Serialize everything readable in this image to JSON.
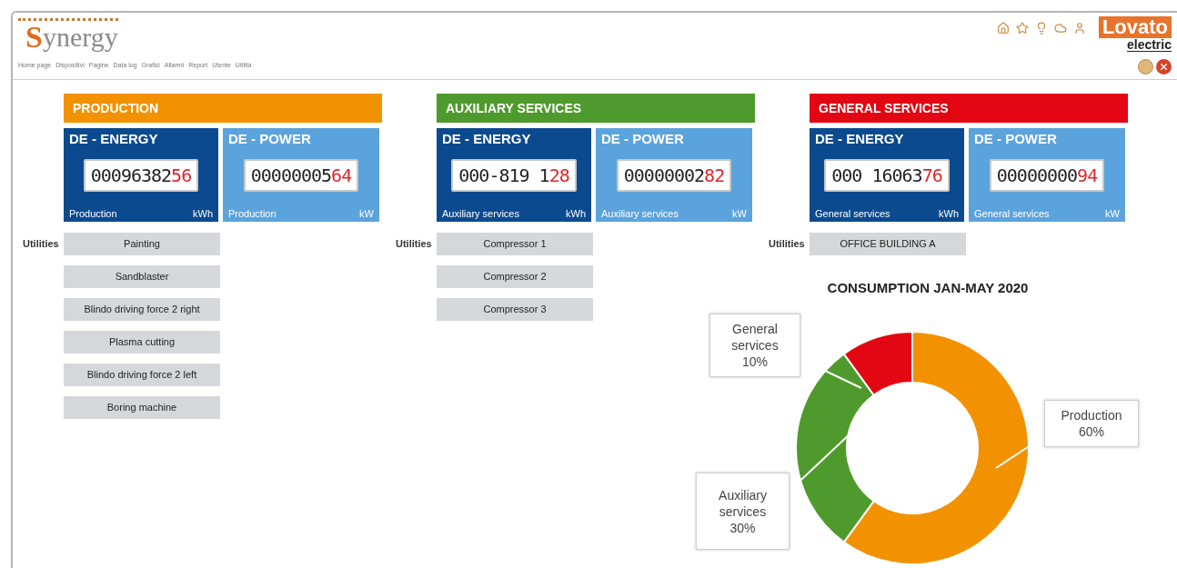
{
  "header": {
    "logo_initial": "S",
    "logo_rest": "ynergy",
    "nav": [
      "Home page",
      "Dispositivi",
      "Pagine",
      "Data log",
      "Grafici",
      "Allarmi",
      "Report",
      "Utente",
      "Utilità"
    ],
    "brand": {
      "name": "Lovato",
      "sub": "electric"
    }
  },
  "groups": [
    {
      "title": "PRODUCTION",
      "color": "#f39200",
      "meters": [
        {
          "kind": "energy",
          "title": "DE - ENERGY",
          "digits": "00096382",
          "red_digits": "56",
          "caption": "Production",
          "unit": "kWh"
        },
        {
          "kind": "power",
          "title": "DE - POWER",
          "digits": "00000005",
          "red_digits": "64",
          "caption": "Production",
          "unit": "kW"
        }
      ],
      "utilities_label": "Utilities",
      "utilities": [
        "Painting",
        "Sandblaster",
        "Blindo driving force 2 right",
        "Plasma cutting",
        "Blindo driving force 2 left",
        "Boring machine"
      ]
    },
    {
      "title": "AUXILIARY SERVICES",
      "color": "#4f9a2c",
      "meters": [
        {
          "kind": "energy",
          "title": "DE - ENERGY",
          "digits": "000-819 1",
          "red_digits": "28",
          "caption": "Auxiliary services",
          "unit": "kWh"
        },
        {
          "kind": "power",
          "title": "DE - POWER",
          "digits": "00000002",
          "red_digits": "82",
          "caption": "Auxiliary services",
          "unit": "kW"
        }
      ],
      "utilities_label": "Utilities",
      "utilities": [
        "Compressor 1",
        "Compressor 2",
        "Compressor 3"
      ]
    },
    {
      "title": "GENERAL SERVICES",
      "color": "#e30613",
      "meters": [
        {
          "kind": "energy",
          "title": "DE - ENERGY",
          "digits": "000 16063",
          "red_digits": "76",
          "caption": "General services",
          "unit": "kWh"
        },
        {
          "kind": "power",
          "title": "DE - POWER",
          "digits": "00000000",
          "red_digits": "94",
          "caption": "General services",
          "unit": "kW"
        }
      ],
      "utilities_label": "Utilities",
      "utilities": [
        "OFFICE BUILDING A"
      ]
    }
  ],
  "chart": {
    "title": "CONSUMPTION JAN-MAY 2020",
    "chart_data": {
      "type": "donut",
      "categories": [
        "Production",
        "Auxiliary services",
        "General services"
      ],
      "values": [
        60,
        30,
        10
      ],
      "value_labels": [
        "60%",
        "30%",
        "10%"
      ]
    }
  }
}
